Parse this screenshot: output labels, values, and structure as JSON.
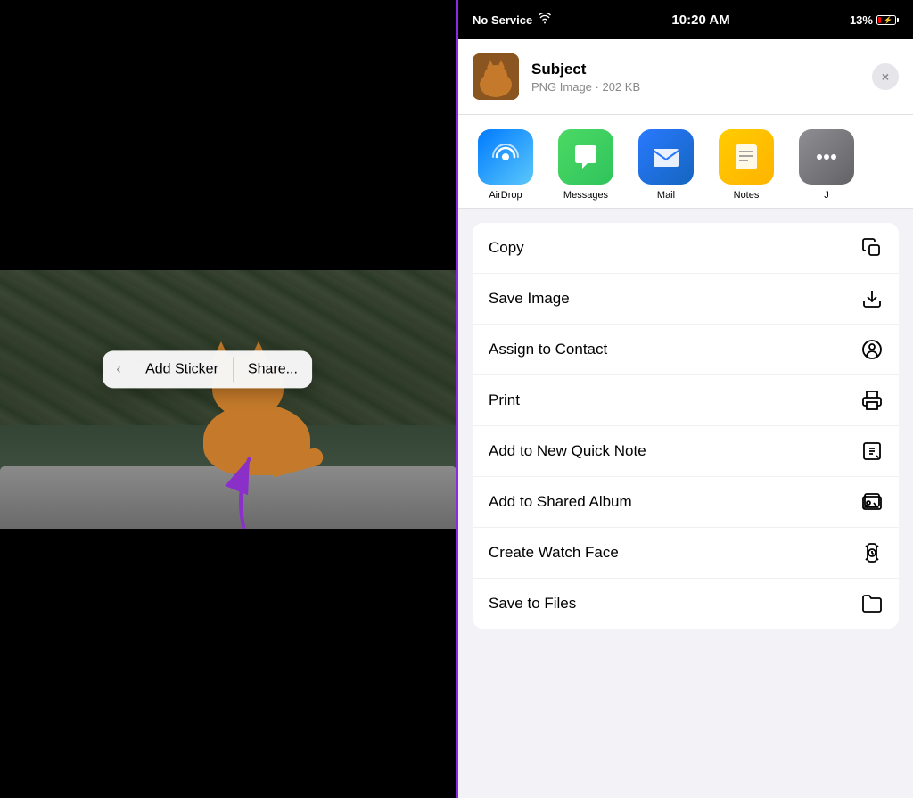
{
  "status_bar": {
    "signal": "No Service",
    "wifi": true,
    "time": "10:20 AM",
    "battery_percent": "13%"
  },
  "left_panel": {
    "context_menu": {
      "back_label": "‹",
      "add_sticker_label": "Add Sticker",
      "share_label": "Share..."
    }
  },
  "share_sheet": {
    "header": {
      "title": "Subject",
      "subtitle": "PNG Image · 202 KB",
      "close_label": "×"
    },
    "app_icons": [
      {
        "name": "AirDrop",
        "type": "airdrop"
      },
      {
        "name": "Messages",
        "type": "messages"
      },
      {
        "name": "Mail",
        "type": "mail"
      },
      {
        "name": "Notes",
        "type": "notes"
      }
    ],
    "actions": [
      {
        "id": "copy",
        "label": "Copy",
        "icon": "copy"
      },
      {
        "id": "save-image",
        "label": "Save Image",
        "icon": "save-image"
      },
      {
        "id": "assign-contact",
        "label": "Assign to Contact",
        "icon": "assign-contact"
      },
      {
        "id": "print",
        "label": "Print",
        "icon": "print"
      },
      {
        "id": "add-quick-note",
        "label": "Add to New Quick Note",
        "icon": "quick-note"
      },
      {
        "id": "add-shared-album",
        "label": "Add to Shared Album",
        "icon": "shared-album"
      },
      {
        "id": "create-watch-face",
        "label": "Create Watch Face",
        "icon": "watch-face"
      },
      {
        "id": "save-to-files",
        "label": "Save to Files",
        "icon": "save-files"
      }
    ]
  }
}
